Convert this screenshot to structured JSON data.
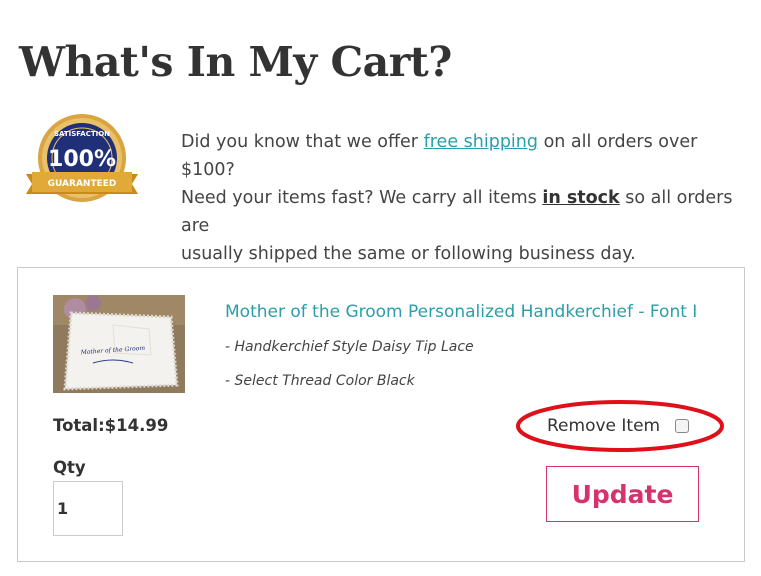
{
  "header": {
    "title": "What's In My Cart?"
  },
  "badge": {
    "top_text": "SATISFACTION",
    "center_text": "100%",
    "ribbon_text": "GUARANTEED"
  },
  "intro": {
    "line1_a": "Did you know that we offer ",
    "free_shipping_link": "free shipping",
    "line1_b": " on all orders over $100?",
    "line2_a": "Need your items fast? We carry all items ",
    "in_stock_link": "in stock",
    "line2_b": " so all orders are",
    "line3": "usually shipped the same or following business day."
  },
  "cart": {
    "item": {
      "image_caption": "Mother of the Groom",
      "title": "Mother of the Groom Personalized Handkerchief - Font I",
      "option1": "- Handkerchief Style Daisy Tip Lace",
      "option2": "- Select Thread Color Black"
    },
    "total": "Total:$14.99",
    "remove_label": "Remove Item",
    "remove_checked": false,
    "qty_label": "Qty",
    "qty_value": "1",
    "update_label": "Update"
  },
  "colors": {
    "link": "#2a9fa8",
    "accent": "#d6336c",
    "highlight_ring": "#e0101b",
    "border": "#c9c9c9"
  }
}
